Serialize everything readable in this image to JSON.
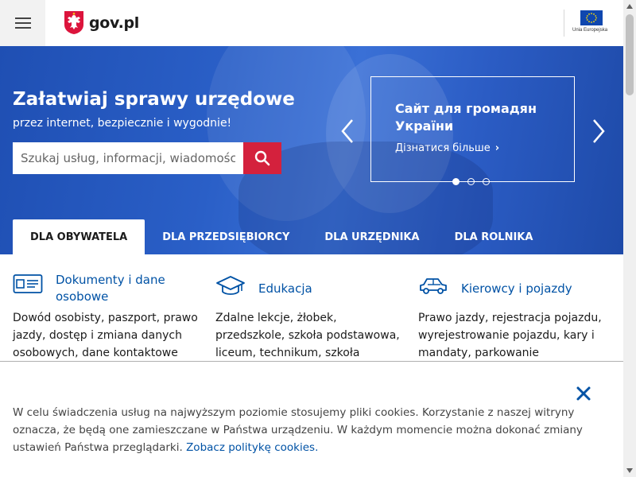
{
  "header": {
    "menu_icon": "hamburger-menu-icon",
    "logo_text": "gov.pl",
    "eu_label": "Unia Europejska"
  },
  "hero": {
    "title": "Załatwiaj sprawy urzędowe",
    "subtitle": "przez internet, bezpiecznie i wygodnie!",
    "search_placeholder": "Szukaj usług, informacji, wiadomości",
    "slide": {
      "title": "Сайт для громадян України",
      "link": "Дізнатися більше"
    },
    "dots": 3,
    "active_dot": 1
  },
  "tabs": [
    {
      "label": "DLA OBYWATELA",
      "active": true
    },
    {
      "label": "DLA PRZEDSIĘBIORCY",
      "active": false
    },
    {
      "label": "DLA URZĘDNIKA",
      "active": false
    },
    {
      "label": "DLA ROLNIKA",
      "active": false
    }
  ],
  "categories": [
    {
      "title": "Dokumenty i dane osobowe",
      "icon": "id-card-icon",
      "desc": "Dowód osobisty, paszport, prawo jazdy, dostęp i zmiana danych osobowych, dane kontaktowe"
    },
    {
      "title": "Edukacja",
      "icon": "graduation-cap-icon",
      "desc": "Zdalne lekcje, żłobek, przedszkole, szkoła podstawowa, liceum, technikum, szkoła branżowa,"
    },
    {
      "title": "Kierowcy i pojazdy",
      "icon": "car-icon",
      "desc": "Prawo jazdy, rejestracja pojazdu, wyrejestrowanie pojazdu, kary i mandaty, parkowanie"
    }
  ],
  "cookie": {
    "text": "W celu świadczenia usług na najwyższym poziomie stosujemy pliki cookies. Korzystanie z naszej witryny oznacza, że będą one zamieszczane w Państwa urządzeniu. W każdym momencie można dokonać zmiany ustawień Państwa przeglądarki.",
    "link": "Zobacz politykę cookies."
  },
  "colors": {
    "brand_blue": "#0052a5",
    "hero_blue": "#2a5fc7",
    "search_red": "#d4213d"
  }
}
